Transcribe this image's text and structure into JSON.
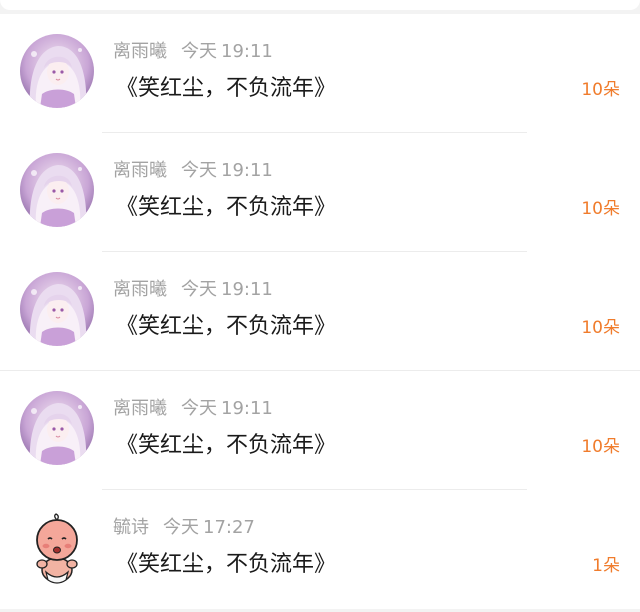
{
  "gifts": [
    {
      "name": "离雨曦",
      "date": "今天",
      "time": "19:11",
      "message": "《笑红尘，不负流年》",
      "count": "10朵",
      "avatar": "anime-girl-avatar"
    },
    {
      "name": "离雨曦",
      "date": "今天",
      "time": "19:11",
      "message": "《笑红尘，不负流年》",
      "count": "10朵",
      "avatar": "anime-girl-avatar"
    },
    {
      "name": "离雨曦",
      "date": "今天",
      "time": "19:11",
      "message": "《笑红尘，不负流年》",
      "count": "10朵",
      "avatar": "anime-girl-avatar"
    },
    {
      "name": "离雨曦",
      "date": "今天",
      "time": "19:11",
      "message": "《笑红尘，不负流年》",
      "count": "10朵",
      "avatar": "anime-girl-avatar"
    },
    {
      "name": "毓诗",
      "date": "今天",
      "time": "17:27",
      "message": "《笑红尘，不负流年》",
      "count": "1朵",
      "avatar": "cartoon-baby-avatar"
    }
  ],
  "colors": {
    "accent": "#f07c2c",
    "meta_text": "#a3a3a3",
    "body_text": "#1a1a1a",
    "background": "#f3f3f3"
  }
}
